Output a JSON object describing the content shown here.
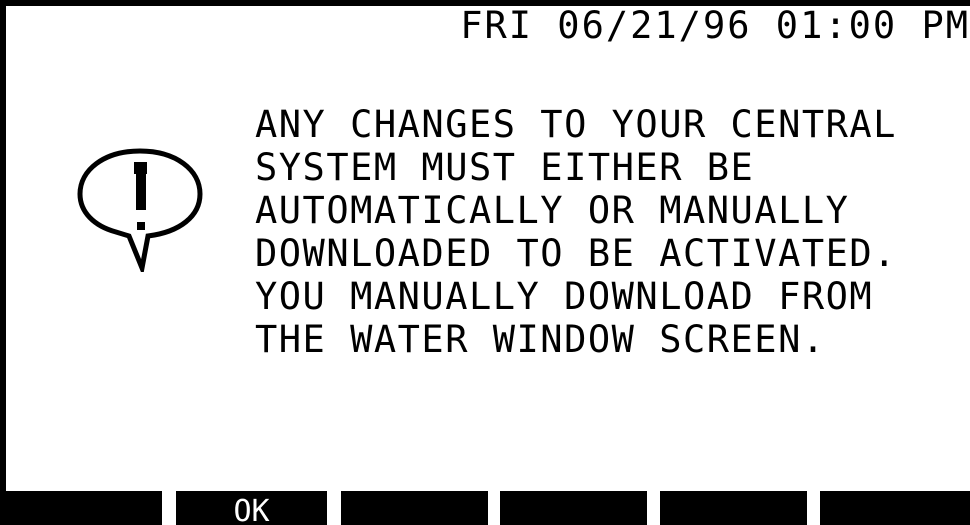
{
  "header": {
    "datetime": "FRI 06/21/96 01:00 PM"
  },
  "alert": {
    "icon": "exclamation-speech-bubble-icon",
    "lines": [
      "ANY CHANGES TO YOUR CENTRAL",
      "SYSTEM MUST EITHER BE",
      "AUTOMATICALLY OR MANUALLY",
      "DOWNLOADED TO BE ACTIVATED.",
      "YOU MANUALLY DOWNLOAD FROM",
      "THE WATER WINDOW SCREEN."
    ]
  },
  "softkeys": [
    {
      "label": ""
    },
    {
      "label": "OK"
    },
    {
      "label": ""
    },
    {
      "label": ""
    },
    {
      "label": ""
    },
    {
      "label": ""
    }
  ],
  "colors": {
    "background": "#ffffff",
    "foreground": "#000000"
  }
}
